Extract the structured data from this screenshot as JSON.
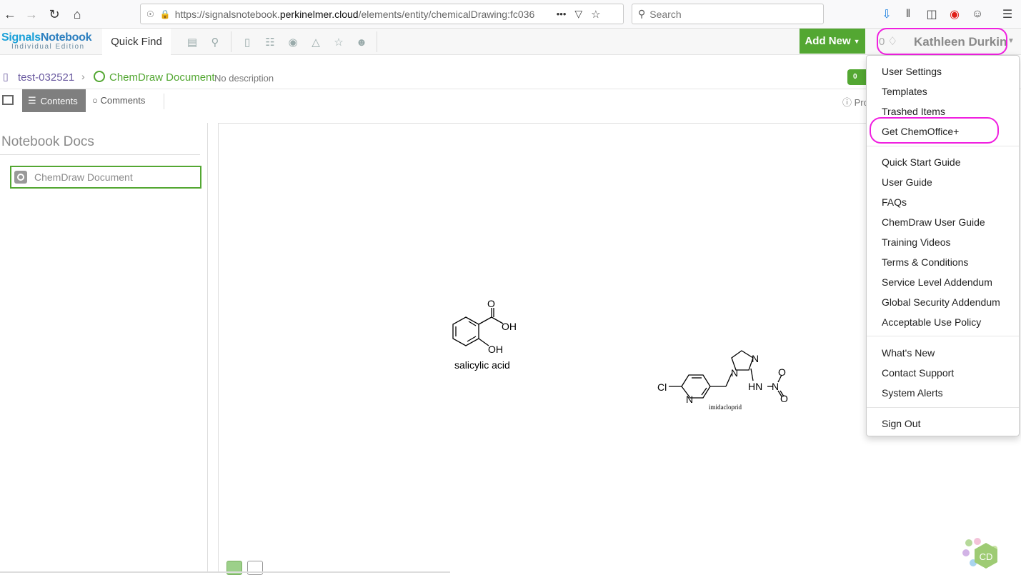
{
  "browser": {
    "url_prefix": "https://signalsnotebook.",
    "url_domain": "perkinelmer.cloud",
    "url_path": "/elements/entity/chemicalDrawing:fc036",
    "more_label": "•••",
    "search_placeholder": "Search"
  },
  "app": {
    "logo_main": "Signals",
    "logo_main2": "Notebook",
    "logo_sub": "Individual Edition",
    "quick_find": "Quick Find",
    "add_new": "Add New",
    "notif_count": "0",
    "user_name": "Kathleen Durkin"
  },
  "breadcrumb": {
    "notebook": "test-032521",
    "document": "ChemDraw Document",
    "description": "No description",
    "comment_count": "0"
  },
  "tabs": {
    "contents": "Contents",
    "comments": "Comments",
    "properties": "Pro"
  },
  "left_panel": {
    "title": "Notebook Docs",
    "items": [
      {
        "label": "ChemDraw Document"
      }
    ]
  },
  "canvas": {
    "molecule1_name": "salicylic acid",
    "molecule1_oh1": "OH",
    "molecule1_oh2": "OH",
    "molecule1_o": "O",
    "molecule2_name": "imidacloprid",
    "molecule2_cl": "Cl",
    "molecule2_n1": "N",
    "molecule2_n2": "N",
    "molecule2_n3": "N",
    "molecule2_hn": "HN",
    "molecule2_no2_n": "N",
    "molecule2_o1": "O",
    "molecule2_o2": "O",
    "badge": "CD"
  },
  "user_menu": {
    "group1": [
      "User Settings",
      "Templates",
      "Trashed Items",
      "Get ChemOffice+"
    ],
    "group2": [
      "Quick Start Guide",
      "User Guide",
      "FAQs",
      "ChemDraw User Guide",
      "Training Videos",
      "Terms & Conditions",
      "Service Level Addendum",
      "Global Security Addendum",
      "Acceptable Use Policy"
    ],
    "group3": [
      "What's New",
      "Contact Support",
      "System Alerts"
    ],
    "group4": [
      "Sign Out"
    ]
  },
  "colors": {
    "brand_green": "#53a732",
    "highlight": "#f020e0",
    "notebook_purple": "#6a5aa0"
  }
}
